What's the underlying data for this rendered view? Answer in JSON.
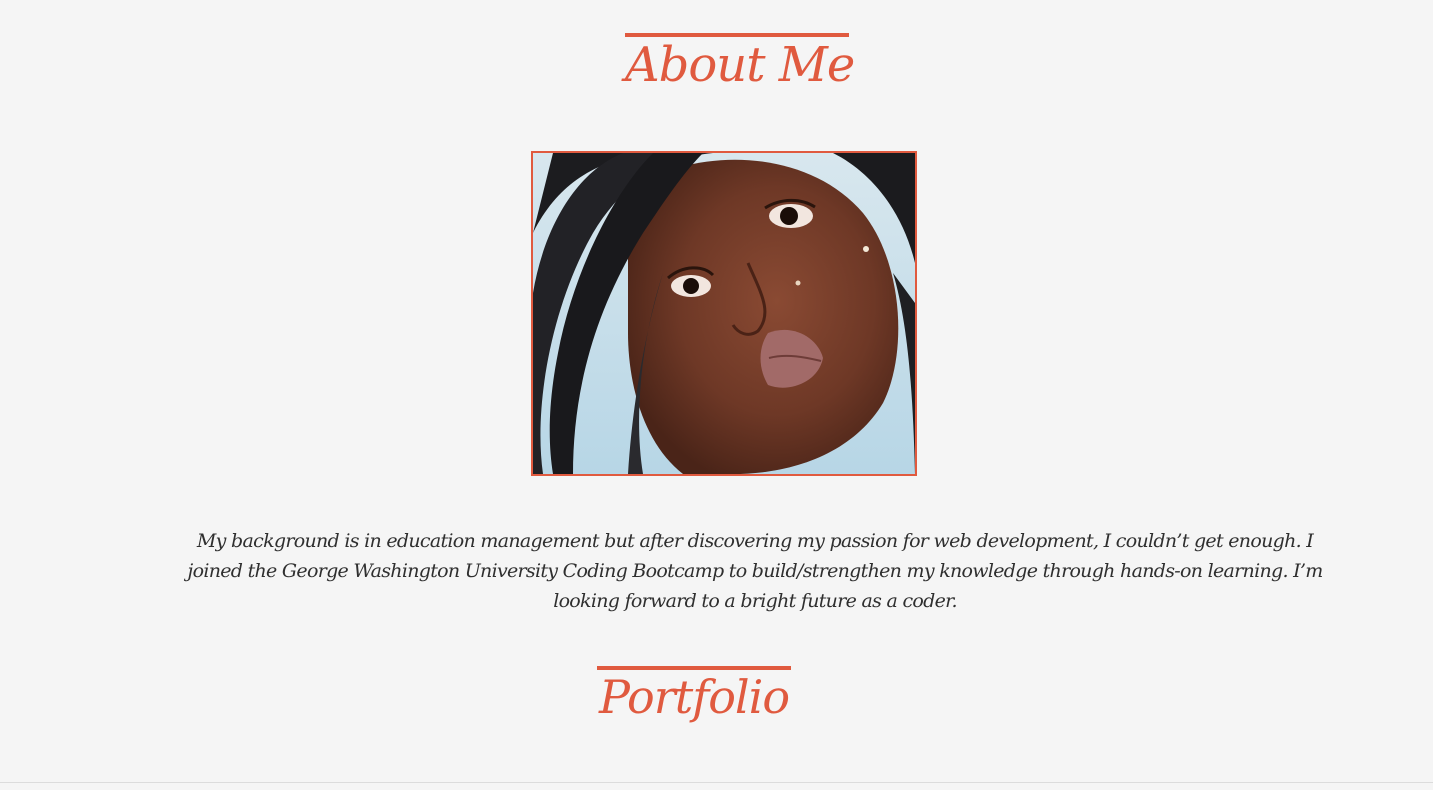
{
  "about": {
    "heading": "About Me",
    "photo_alt": "Profile photo",
    "bio": "My background is in education management but after discovering my passion for web development, I couldn’t get enough. I joined the George Washington University Coding Bootcamp to build/strengthen my knowledge through hands-on learning. I’m looking forward to a bright future as a coder."
  },
  "portfolio": {
    "heading": "Portfolio"
  },
  "colors": {
    "accent": "#e05a3f",
    "background": "#f5f5f5",
    "text": "#2f2f2f"
  }
}
